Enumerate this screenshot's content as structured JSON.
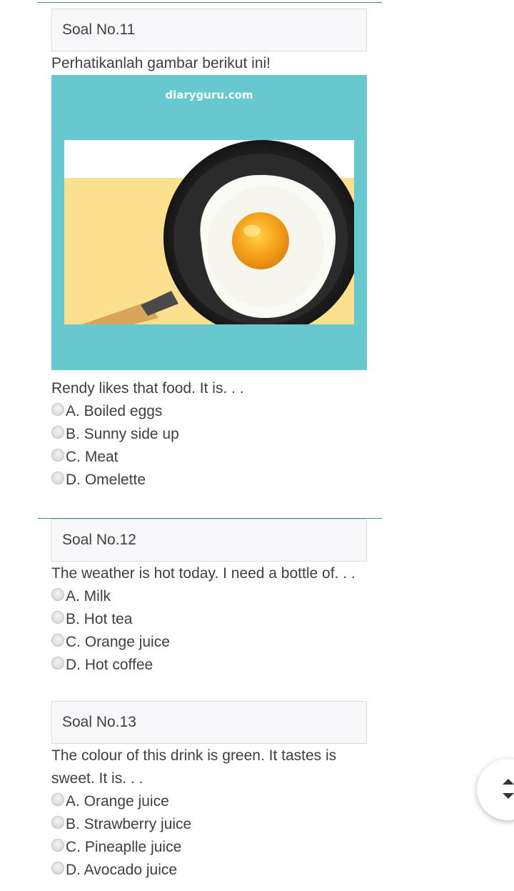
{
  "questions": [
    {
      "header": "Soal No.11",
      "instruction": "Perhatikanlah gambar berikut ini!",
      "image_watermark": "diaryguru.com",
      "prompt": "Rendy likes that food. It is. . .",
      "options": [
        "A. Boiled eggs",
        "B. Sunny side up",
        "C. Meat",
        "D. Omelette"
      ]
    },
    {
      "header": "Soal No.12",
      "prompt": "The weather is hot today. I need a bottle of. . .",
      "options": [
        "A. Milk",
        "B. Hot tea",
        "C. Orange juice",
        "D. Hot coffee"
      ]
    },
    {
      "header": "Soal No.13",
      "prompt_line1": "The colour of this drink is green. It tastes is",
      "prompt_line2": "sweet. It is. . .",
      "options": [
        "A. Orange juice",
        "B. Strawberry juice",
        "C. Pineaplle juice",
        "D. Avocado juice"
      ]
    }
  ],
  "colors": {
    "divider": "#3a8f9a",
    "image_background": "#66c9cf",
    "header_background": "#f8f8fa"
  },
  "icons": {
    "scroll_control": "up-down-arrows-icon",
    "option_marker": "radio-unchecked-icon"
  }
}
